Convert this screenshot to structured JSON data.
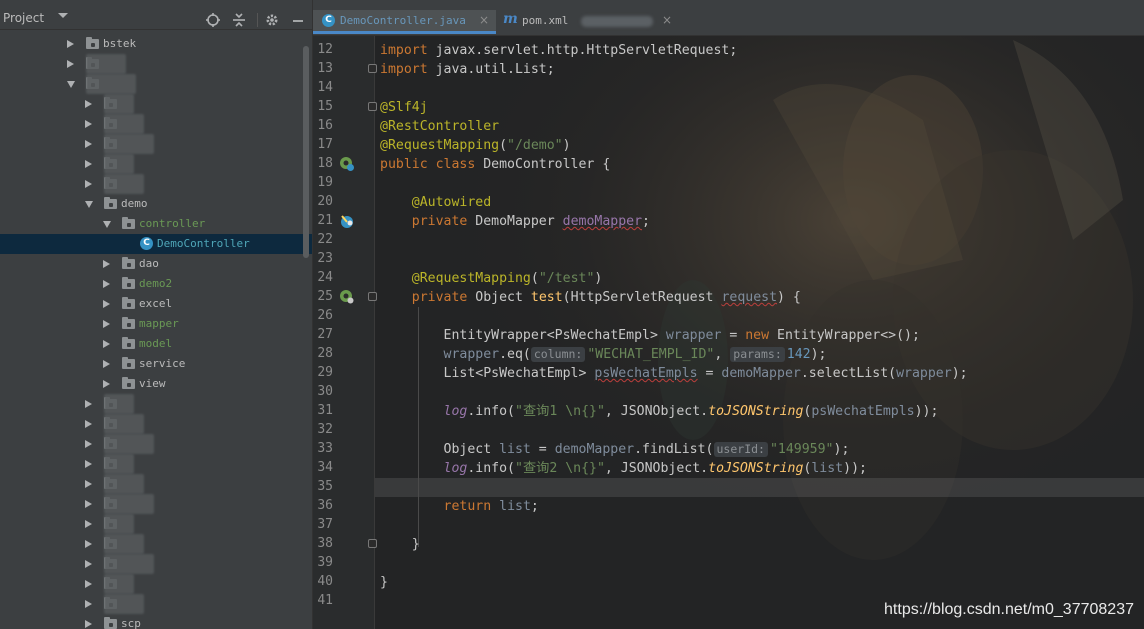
{
  "project_panel": {
    "title": "Project",
    "tree": [
      {
        "label": "bstek",
        "state": "collapsed",
        "kind": "folder"
      },
      {
        "label": "",
        "state": "collapsed",
        "kind": "folder",
        "redacted": true
      },
      {
        "label": "",
        "state": "expanded",
        "kind": "folder",
        "redacted": true
      },
      {
        "label": "",
        "state": "collapsed",
        "kind": "folder",
        "redacted": true
      },
      {
        "label": "",
        "state": "collapsed",
        "kind": "folder",
        "redacted": true
      },
      {
        "label": "",
        "state": "collapsed",
        "kind": "folder",
        "redacted": true
      },
      {
        "label": "",
        "state": "collapsed",
        "kind": "folder",
        "redacted": true
      },
      {
        "label": "",
        "state": "collapsed",
        "kind": "folder",
        "redacted": true
      },
      {
        "label": "demo",
        "state": "expanded",
        "kind": "folder"
      },
      {
        "label": "controller",
        "state": "expanded",
        "kind": "folder",
        "color": "green"
      },
      {
        "label": "DemoController",
        "state": "none",
        "kind": "class",
        "selected": true
      },
      {
        "label": "dao",
        "state": "collapsed",
        "kind": "folder"
      },
      {
        "label": "demo2",
        "state": "collapsed",
        "kind": "folder",
        "color": "green"
      },
      {
        "label": "excel",
        "state": "collapsed",
        "kind": "folder"
      },
      {
        "label": "mapper",
        "state": "collapsed",
        "kind": "folder",
        "color": "green"
      },
      {
        "label": "model",
        "state": "collapsed",
        "kind": "folder",
        "color": "green"
      },
      {
        "label": "service",
        "state": "collapsed",
        "kind": "folder"
      },
      {
        "label": "view",
        "state": "collapsed",
        "kind": "folder"
      },
      {
        "label": "",
        "state": "collapsed",
        "kind": "folder",
        "redacted": true
      },
      {
        "label": "",
        "state": "collapsed",
        "kind": "folder",
        "redacted": true
      },
      {
        "label": "",
        "state": "collapsed",
        "kind": "folder",
        "redacted": true
      },
      {
        "label": "",
        "state": "collapsed",
        "kind": "folder",
        "redacted": true
      },
      {
        "label": "",
        "state": "collapsed",
        "kind": "folder",
        "redacted": true
      },
      {
        "label": "",
        "state": "collapsed",
        "kind": "folder",
        "redacted": true
      },
      {
        "label": "",
        "state": "collapsed",
        "kind": "folder",
        "redacted": true
      },
      {
        "label": "",
        "state": "collapsed",
        "kind": "folder",
        "redacted": true
      },
      {
        "label": "",
        "state": "collapsed",
        "kind": "folder",
        "redacted": true
      },
      {
        "label": "",
        "state": "collapsed",
        "kind": "folder",
        "redacted": true
      },
      {
        "label": "",
        "state": "collapsed",
        "kind": "folder",
        "redacted": true
      },
      {
        "label": "scp",
        "state": "collapsed",
        "kind": "folder"
      }
    ]
  },
  "tabs": [
    {
      "label": "DemoController.java",
      "active": true,
      "icon": "class-icon"
    },
    {
      "label": "pom.xml",
      "active": false,
      "icon": "maven-icon"
    }
  ],
  "editor": {
    "line_numbers": [
      "12",
      "13",
      "14",
      "15",
      "16",
      "17",
      "18",
      "19",
      "20",
      "21",
      "22",
      "23",
      "24",
      "25",
      "26",
      "27",
      "28",
      "29",
      "30",
      "31",
      "32",
      "33",
      "34",
      "35",
      "36",
      "37",
      "38",
      "39",
      "40",
      "41"
    ],
    "current_line": "35",
    "hints": {
      "column": "column:",
      "params": "params:",
      "userId": "userId:"
    }
  },
  "colors": {
    "keyword": "#cc7832",
    "annotation": "#bbb529",
    "string": "#6a8759",
    "number": "#6897bb",
    "field": "#9876aa",
    "method": "#ffc66d",
    "selection": "#0d293e",
    "tab_underline": "#4a88c7"
  },
  "watermark": "https://blog.csdn.net/m0_37708237"
}
